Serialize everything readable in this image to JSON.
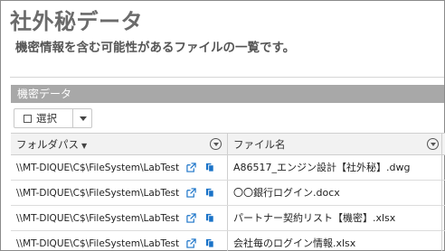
{
  "page": {
    "title": "社外秘データ",
    "description": "機密情報を含む可能性があるファイルの一覧です。"
  },
  "panel": {
    "header": "機密データ"
  },
  "toolbar": {
    "select_label": "選択"
  },
  "table": {
    "columns": [
      {
        "label": "フォルダパス",
        "sort": "descending",
        "icon": "filter-icon"
      },
      {
        "label": "ファイル名",
        "icon": "filter-icon"
      }
    ],
    "rows": [
      {
        "path": "\\\\MT-DIQUE\\C$\\FileSystem\\LabTest",
        "file": "A86517_エンジン設計【社外秘】.dwg"
      },
      {
        "path": "\\\\MT-DIQUE\\C$\\FileSystem\\LabTest",
        "file": "〇〇銀行ログイン.docx"
      },
      {
        "path": "\\\\MT-DIQUE\\C$\\FileSystem\\LabTest",
        "file": "パートナー契約リスト【機密】.xlsx"
      },
      {
        "path": "\\\\MT-DIQUE\\C$\\FileSystem\\LabTest",
        "file": "会社毎のログイン情報.xlsx"
      }
    ]
  },
  "colors": {
    "panel_header_bg": "#a8a8a8",
    "icon_blue": "#1a73c8",
    "title_gray": "#6b6b6b"
  }
}
